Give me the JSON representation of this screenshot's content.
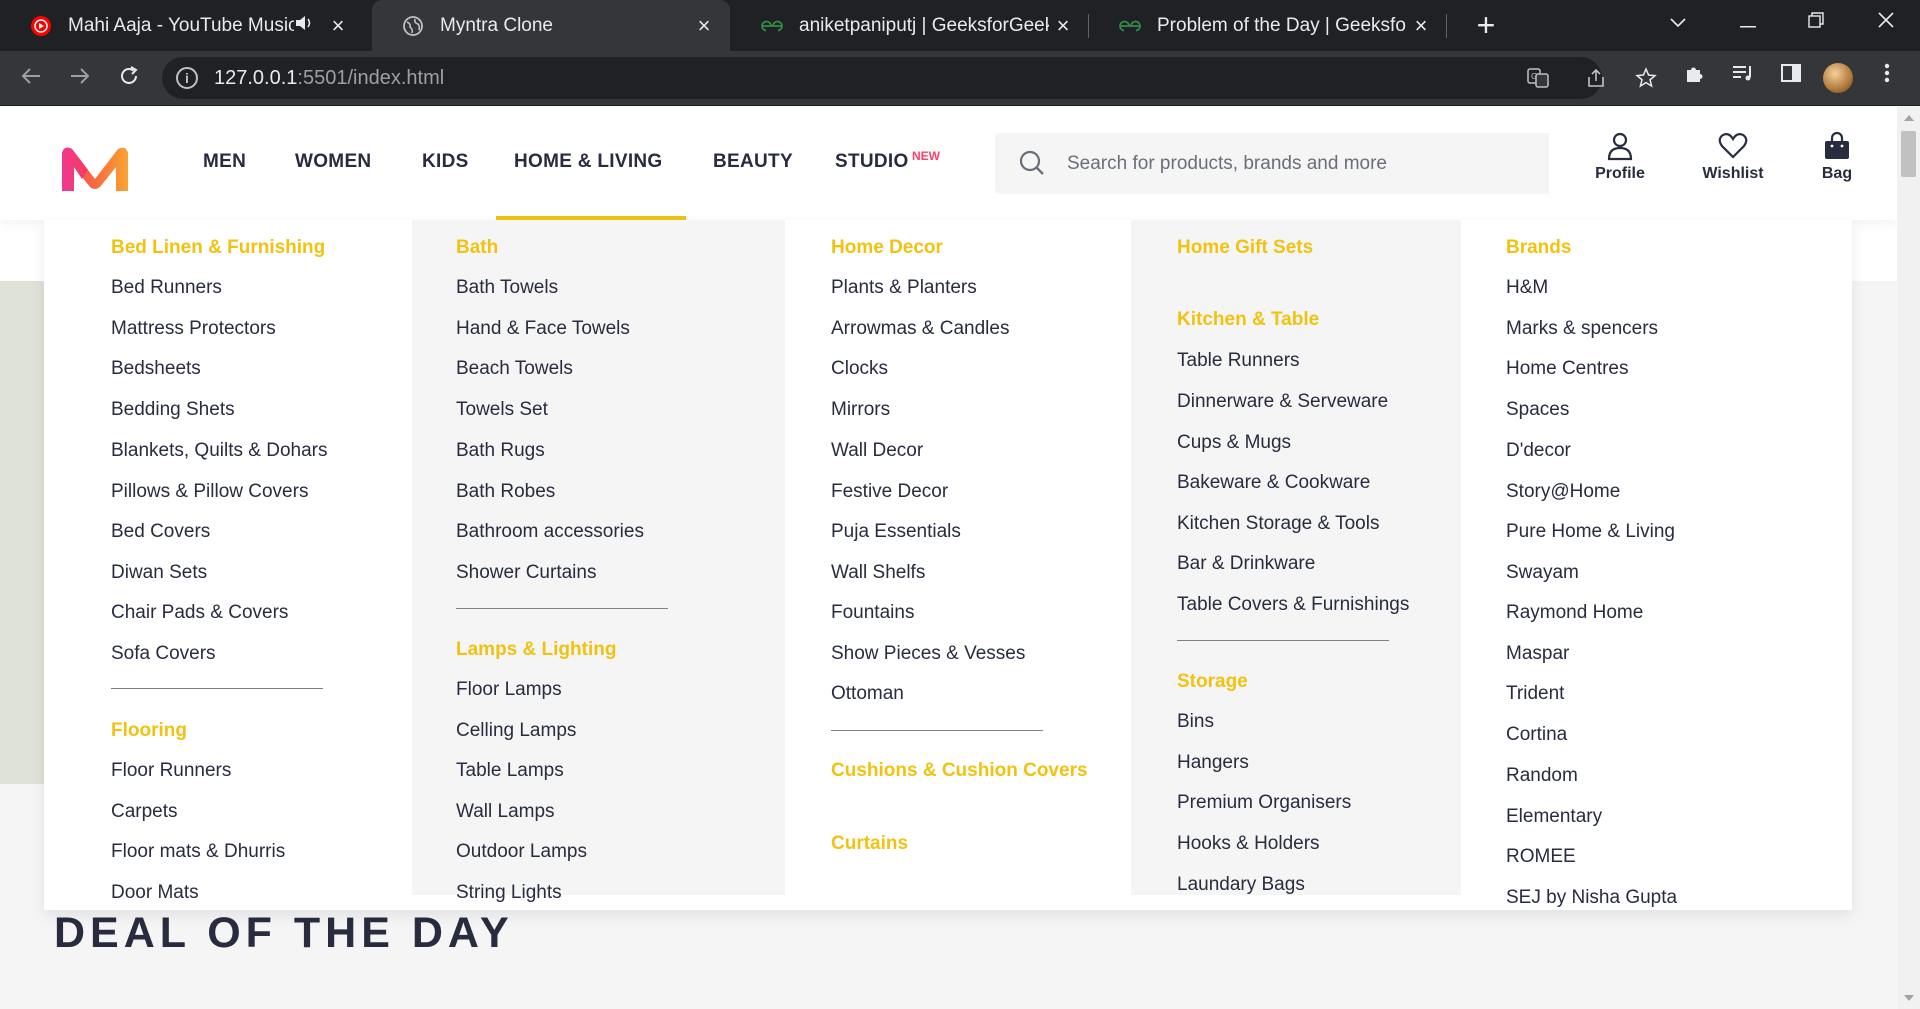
{
  "browser": {
    "tabs": [
      {
        "title": "Mahi Aaja - YouTube Music",
        "active": false,
        "favicon": "youtube-music-icon",
        "audio": true
      },
      {
        "title": "Myntra Clone",
        "active": true,
        "favicon": "globe-icon"
      },
      {
        "title": "aniketpaniputj | GeeksforGeeks P",
        "active": false,
        "favicon": "geeksforgeeks-icon"
      },
      {
        "title": "Problem of the Day | GeeksforGe",
        "active": false,
        "favicon": "geeksforgeeks-icon"
      }
    ],
    "url_host": "127.0.0.1",
    "url_rest": ":5501/index.html"
  },
  "header": {
    "nav": [
      "MEN",
      "WOMEN",
      "KIDS",
      "HOME & LIVING",
      "BEAUTY",
      "STUDIO"
    ],
    "new_badge": "NEW",
    "search_placeholder": "Search for products, brands and more",
    "actions": [
      "Profile",
      "Wishlist",
      "Bag"
    ]
  },
  "colors": {
    "accent": "#f2c210",
    "brand_pink": "#ff3f6c",
    "text": "#282c3f"
  },
  "dropdown": {
    "col1": {
      "groups": [
        {
          "heading": "Bed Linen & Furnishing",
          "items": [
            "Bed Runners",
            "Mattress Protectors",
            "Bedsheets",
            "Bedding Shets",
            "Blankets, Quilts & Dohars",
            "Pillows & Pillow Covers",
            "Bed Covers",
            "Diwan Sets",
            "Chair Pads & Covers",
            "Sofa Covers"
          ]
        },
        {
          "heading": "Flooring",
          "items": [
            "Floor Runners",
            "Carpets",
            "Floor mats & Dhurris",
            "Door Mats"
          ]
        }
      ]
    },
    "col2": {
      "groups": [
        {
          "heading": "Bath",
          "items": [
            "Bath Towels",
            "Hand & Face Towels",
            "Beach Towels",
            "Towels Set",
            "Bath Rugs",
            "Bath Robes",
            "Bathroom accessories",
            "Shower Curtains"
          ]
        },
        {
          "heading": "Lamps & Lighting",
          "items": [
            "Floor Lamps",
            "Celling Lamps",
            "Table Lamps",
            "Wall Lamps",
            "Outdoor Lamps",
            "String Lights"
          ]
        }
      ]
    },
    "col3": {
      "groups": [
        {
          "heading": "Home Decor",
          "items": [
            "Plants & Planters",
            "Arrowmas & Candles",
            "Clocks",
            "Mirrors",
            "Wall Decor",
            "Festive Decor",
            "Puja Essentials",
            "Wall Shelfs",
            "Fountains",
            "Show Pieces & Vesses",
            "Ottoman"
          ]
        },
        {
          "heading": "Cushions & Cushion Covers",
          "items": []
        },
        {
          "heading": "Curtains",
          "items": []
        }
      ]
    },
    "col4": {
      "groups": [
        {
          "heading": "Home Gift Sets",
          "items": []
        },
        {
          "heading": "Kitchen & Table",
          "items": [
            "Table Runners",
            "Dinnerware & Serveware",
            "Cups & Mugs",
            "Bakeware & Cookware",
            "Kitchen Storage & Tools",
            "Bar & Drinkware",
            "Table Covers & Furnishings"
          ]
        },
        {
          "heading": "Storage",
          "items": [
            "Bins",
            "Hangers",
            "Premium Organisers",
            "Hooks & Holders",
            "Laundary Bags"
          ]
        }
      ]
    },
    "col5": {
      "groups": [
        {
          "heading": "Brands",
          "items": [
            "H&M",
            "Marks & spencers",
            "Home Centres",
            "Spaces",
            "D'decor",
            "Story@Home",
            "Pure Home & Living",
            "Swayam",
            "Raymond Home",
            "Maspar",
            "Trident",
            "Cortina",
            "Random",
            "Elementary",
            "ROMEE",
            "SEJ by Nisha Gupta"
          ]
        }
      ]
    }
  },
  "section_title": "DEAL OF THE DAY"
}
